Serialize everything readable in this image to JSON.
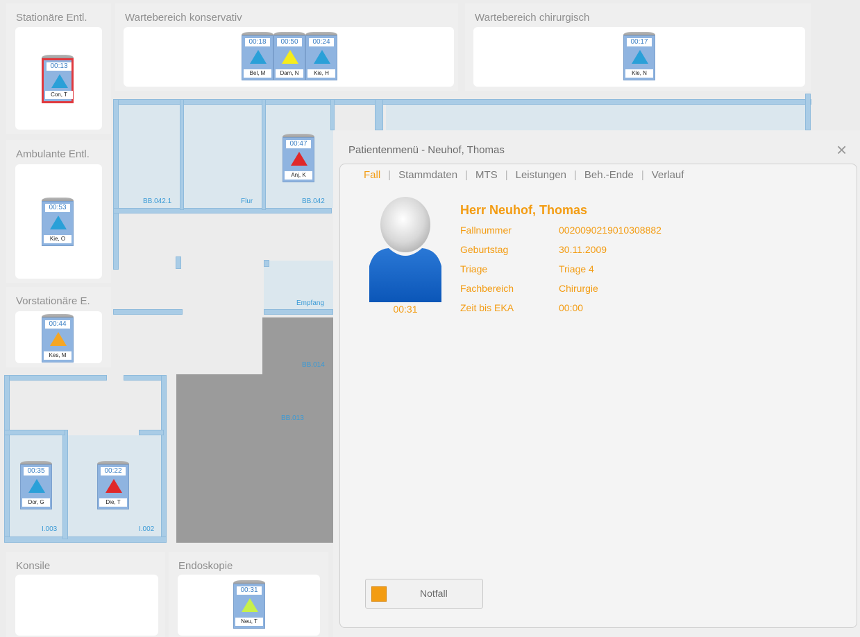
{
  "zones": {
    "stationaer": {
      "title": "Stationäre Entl."
    },
    "ambulant": {
      "title": "Ambulante Entl."
    },
    "vorstationaer": {
      "title": "Vorstationäre E."
    },
    "konservativ": {
      "title": "Wartebereich konservativ"
    },
    "chirurgisch": {
      "title": "Wartebereich chirurgisch"
    },
    "konsile": {
      "title": "Konsile"
    },
    "endoskopie": {
      "title": "Endoskopie"
    }
  },
  "cards": [
    {
      "time": "00:13",
      "name": "Con, T",
      "triage_color": "#2aa0d8",
      "alert": true
    },
    {
      "time": "00:18",
      "name": "Bel, M",
      "triage_color": "#2aa0d8"
    },
    {
      "time": "00:50",
      "name": "Dam, N",
      "triage_color": "#f5ec1d"
    },
    {
      "time": "00:24",
      "name": "Kie, H",
      "triage_color": "#2aa0d8"
    },
    {
      "time": "00:17",
      "name": "Kle, N",
      "triage_color": "#2aa0d8"
    },
    {
      "time": "00:47",
      "name": "Anj, K",
      "triage_color": "#e0282a"
    },
    {
      "time": "00:53",
      "name": "Kie, O",
      "triage_color": "#2aa0d8"
    },
    {
      "time": "00:44",
      "name": "Kes, M",
      "triage_color": "#f5a623"
    },
    {
      "time": "00:35",
      "name": "Dor, G",
      "triage_color": "#2aa0d8"
    },
    {
      "time": "00:22",
      "name": "Die, T",
      "triage_color": "#e0282a"
    },
    {
      "time": "00:31",
      "name": "Neu, T",
      "triage_color": "#c8f04a"
    }
  ],
  "rooms": {
    "bb0421": "BB.042.1",
    "flur": "Flur",
    "bb042": "BB.042",
    "empfang": "Empfang",
    "bb014": "BB.014",
    "bb013": "BB.013",
    "i003": "I.003",
    "i002": "I.002"
  },
  "dialog": {
    "title": "Patientenmenü  -  Neuhof, Thomas",
    "close_icon": "×",
    "tabs": [
      "Fall",
      "Stammdaten",
      "MTS",
      "Leistungen",
      "Beh.-Ende",
      "Verlauf"
    ],
    "active_tab": "Fall",
    "patient": {
      "heading": "Herr  Neuhof, Thomas",
      "waiting_time": "00:31",
      "rows": [
        {
          "label": "Fallnummer",
          "value": "0020090219010308882"
        },
        {
          "label": "Geburtstag",
          "value": "30.11.2009"
        },
        {
          "label": "Triage",
          "value": "Triage 4"
        },
        {
          "label": "Fachbereich",
          "value": "Chirurgie"
        },
        {
          "label": "Zeit bis EKA",
          "value": "00:00"
        }
      ]
    },
    "notfall_label": "Notfall",
    "colors": {
      "accent": "#f39c12"
    }
  }
}
